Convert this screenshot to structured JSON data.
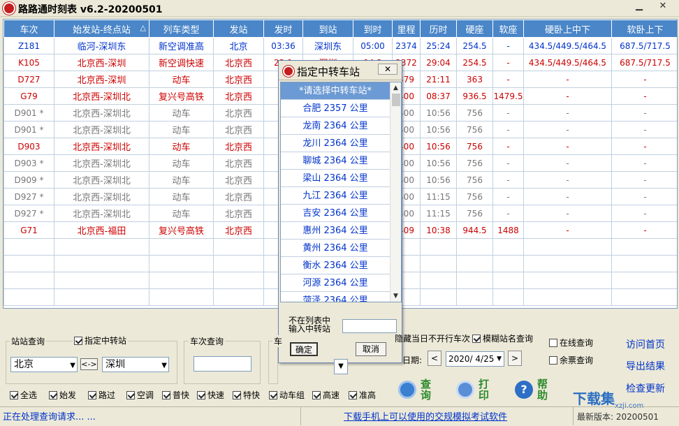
{
  "window": {
    "title": "路路通时刻表 v6.2-20200501",
    "minimize": "▁",
    "close": "✕"
  },
  "table": {
    "headers": [
      "车次",
      "始发站-终点站",
      "列车类型",
      "发站",
      "发时",
      "到站",
      "到时",
      "里程",
      "历时",
      "硬座",
      "软座",
      "硬卧上中下",
      "软卧上下"
    ],
    "sort_indicator": "△",
    "rows": [
      {
        "style": "blue",
        "cells": [
          "Z181",
          "临河-深圳东",
          "新空调准高",
          "北京",
          "03:36",
          "深圳东",
          "05:00",
          "2374",
          "25:24",
          "254.5",
          "-",
          "434.5/449.5/464.5",
          "687.5/717.5"
        ]
      },
      {
        "style": "red",
        "cells": [
          "K105",
          "北京西-深圳",
          "新空调快速",
          "北京西",
          "23:1",
          "深圳",
          "04:2",
          "2372",
          "29:04",
          "254.5",
          "-",
          "434.5/449.5/464.5",
          "687.5/717.5"
        ]
      },
      {
        "style": "red",
        "cells": [
          "D727",
          "北京西-深圳",
          "动车",
          "北京西",
          "19",
          "",
          "",
          "379",
          "21:11",
          "363",
          "-",
          "-",
          "-"
        ]
      },
      {
        "style": "red",
        "cells": [
          "G79",
          "北京西-深圳北",
          "复兴号高铁",
          "北京西",
          "10",
          "",
          "",
          "400",
          "08:37",
          "936.5",
          "1479.5",
          "-",
          "-"
        ]
      },
      {
        "style": "gray",
        "cells": [
          "D901 *",
          "北京西-深圳北",
          "动车",
          "北京西",
          "20",
          "",
          "",
          "400",
          "10:56",
          "756",
          "-",
          "-",
          "-"
        ]
      },
      {
        "style": "gray",
        "cells": [
          "D901 *",
          "北京西-深圳北",
          "动车",
          "北京西",
          "20",
          "",
          "",
          "400",
          "10:56",
          "756",
          "-",
          "-",
          "-"
        ]
      },
      {
        "style": "red",
        "cells": [
          "D903",
          "北京西-深圳北",
          "动车",
          "北京西",
          "20",
          "",
          "",
          "400",
          "10:56",
          "756",
          "-",
          "-",
          "-"
        ]
      },
      {
        "style": "gray",
        "cells": [
          "D903 *",
          "北京西-深圳北",
          "动车",
          "北京西",
          "20",
          "",
          "",
          "400",
          "10:56",
          "756",
          "-",
          "-",
          "-"
        ]
      },
      {
        "style": "gray",
        "cells": [
          "D909 *",
          "北京西-深圳北",
          "动车",
          "北京西",
          "20",
          "",
          "",
          "400",
          "10:56",
          "756",
          "-",
          "-",
          "-"
        ]
      },
      {
        "style": "gray",
        "cells": [
          "D927 *",
          "北京西-深圳北",
          "动车",
          "北京西",
          "20",
          "",
          "",
          "400",
          "11:15",
          "756",
          "-",
          "-",
          "-"
        ]
      },
      {
        "style": "gray",
        "cells": [
          "D927 *",
          "北京西-深圳北",
          "动车",
          "北京西",
          "20",
          "",
          "",
          "400",
          "11:15",
          "756",
          "-",
          "-",
          "-"
        ]
      },
      {
        "style": "red",
        "cells": [
          "G71",
          "北京西-福田",
          "复兴号高铁",
          "北京西",
          "07",
          "",
          "",
          "409",
          "10:38",
          "944.5",
          "1488",
          "-",
          "-"
        ]
      }
    ]
  },
  "dialog": {
    "title": "指定中转车站",
    "close": "✕",
    "list": [
      "*请选择中转车站*",
      "合肥 2357 公里",
      "龙南 2364 公里",
      "龙川 2364 公里",
      "聊城 2364 公里",
      "梁山 2364 公里",
      "九江 2364 公里",
      "吉安 2364 公里",
      "惠州 2364 公里",
      "黄州 2364 公里",
      "衡水 2364 公里",
      "河源 2364 公里",
      "菏泽 2364 公里"
    ],
    "input_label_1": "不在列表中",
    "input_label_2": "输入中转站",
    "input_value": "",
    "ok": "确定",
    "cancel": "取消"
  },
  "station_query": {
    "group_label": "站站查询",
    "transfer_label": "指定中转站",
    "from": "北京",
    "swap": "<->",
    "to": "深圳"
  },
  "train_query": {
    "group_label": "车次查询",
    "input_value": "",
    "cut_label": "车"
  },
  "options": {
    "hide_not_running": "隐藏当日不开行车次",
    "fuzzy_name": "模糊站名查询",
    "date_label": "日期:",
    "date_value": "2020/ 4/25",
    "prev": "<",
    "next": ">",
    "online": "在线查询",
    "remaining": "余票查询"
  },
  "links": {
    "home": "访问首页",
    "export": "导出结果",
    "update": "检查更新"
  },
  "buttons": {
    "query_1": "查",
    "query_2": "询",
    "print_1": "打",
    "print_2": "印",
    "help_1": "帮",
    "help_2": "助"
  },
  "filters": [
    "全选",
    "始发",
    "路过",
    "空调",
    "普快",
    "快速",
    "特快",
    "动车组",
    "高速",
    "准高"
  ],
  "status": {
    "left": "正在处理查询请求... ...",
    "middle": "下载手机上可以使用的交规模拟考试软件",
    "right": "最新版本: 20200501"
  },
  "watermark": {
    "text": "下载集",
    "sub": "xzji.com"
  },
  "colors": {
    "header_bg": "#4a86c8",
    "red": "#cc0000",
    "blue": "#0033cc",
    "gray": "#777777"
  }
}
